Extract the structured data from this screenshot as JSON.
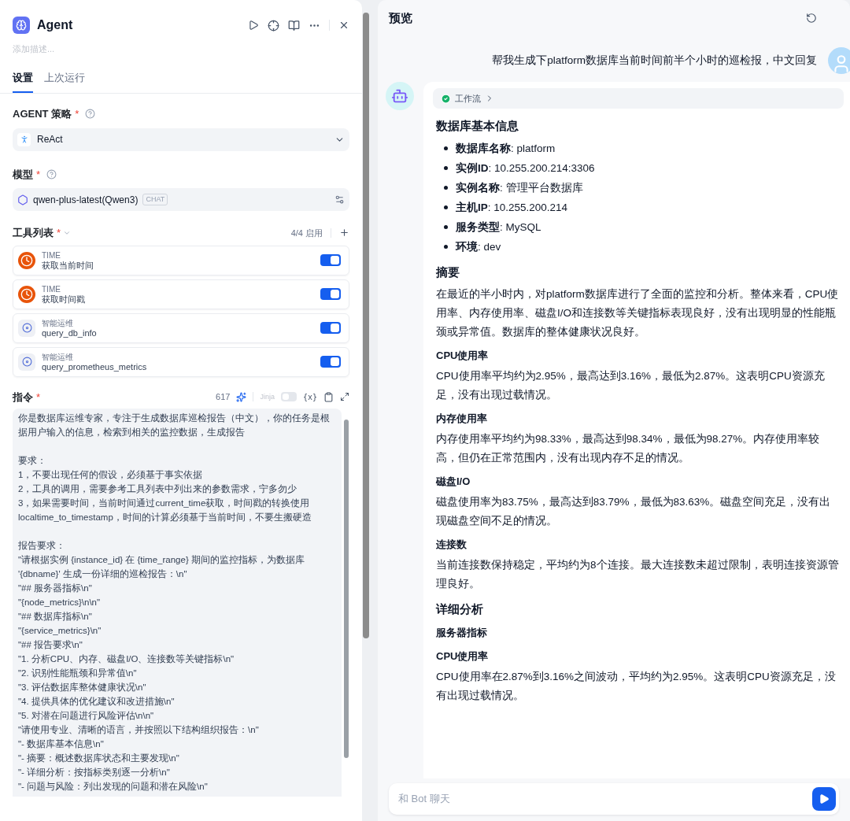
{
  "node": {
    "title": "Agent",
    "description_placeholder": "添加描述..."
  },
  "tabs": [
    {
      "label": "设置",
      "selected": true
    },
    {
      "label": "上次运行",
      "selected": false
    }
  ],
  "strategy": {
    "label": "AGENT 策略",
    "mark": "*",
    "value": "ReAct"
  },
  "model": {
    "label": "模型",
    "mark": "*",
    "value": "qwen-plus-latest(Qwen3)",
    "badge": "CHAT"
  },
  "tools": {
    "label": "工具列表",
    "mark": "*",
    "count": "4/4 启用",
    "items": [
      {
        "provider": "TIME",
        "name": "获取当前时间",
        "kind": "clock",
        "on": true
      },
      {
        "provider": "TIME",
        "name": "获取时间戳",
        "kind": "clock",
        "on": true
      },
      {
        "provider": "智能运维",
        "name": "query_db_info",
        "kind": "ops",
        "on": true
      },
      {
        "provider": "智能运维",
        "name": "query_prometheus_metrics",
        "kind": "ops",
        "on": true
      }
    ]
  },
  "instruction": {
    "label": "指令",
    "mark": "*",
    "count": "617",
    "jinja_label": "Jinja",
    "jinja_on": false,
    "variable_button": "{x}",
    "paragraphs": [
      [
        "你是数据库运维专家，专注于生成数据库巡检报告（中文），你的任务是根据用户输入的信息，检索到相关的监控数据，生成报告"
      ],
      [
        "要求：",
        "1，不要出现任何的假设，必须基于事实依据",
        "2，工具的调用，需要参考工具列表中列出来的参数需求，宁多勿少",
        "3，如果需要时间，当前时间通过current_time获取，时间戳的转换使用localtime_to_timestamp，时间的计算必须基于当前时间，不要生搬硬造"
      ],
      [
        "报告要求：",
        "\"请根据实例 {instance_id} 在 {time_range} 期间的监控指标，为数据库 '{dbname}' 生成一份详细的巡检报告：\\n\"",
        "\"## 服务器指标\\n\"",
        "\"{node_metrics}\\n\\n\"",
        "\"## 数据库指标\\n\"",
        "\"{service_metrics}\\n\"",
        "\"## 报告要求\\n\"",
        "\"1. 分析CPU、内存、磁盘I/O、连接数等关键指标\\n\"",
        "\"2. 识别性能瓶颈和异常值\\n\"",
        "\"3. 评估数据库整体健康状况\\n\"",
        "\"4. 提供具体的优化建议和改进措施\\n\"",
        "\"5. 对潜在问题进行风险评估\\n\\n\"",
        "\"请使用专业、清晰的语言，并按照以下结构组织报告：\\n\"",
        "\"- 数据库基本信息\\n\"",
        "\"- 摘要：概述数据库状态和主要发现\\n\"",
        "\"- 详细分析：按指标类别逐一分析\\n\"",
        "\"- 问题与风险：列出发现的问题和潜在风险\\n\""
      ]
    ]
  },
  "preview": {
    "title": "预览",
    "user_message": "帮我生成下platform数据库当前时间前半个小时的巡检报，中文回复",
    "workflow_label": "工作流",
    "workflow_ok": true,
    "answer": [
      {
        "kind": "h2",
        "text": "数据库基本信息"
      },
      {
        "kind": "list",
        "items": [
          "**数据库名称**: platform",
          "**实例ID**: 10.255.200.214:3306",
          "**实例名称**: 管理平台数据库",
          "**主机IP**: 10.255.200.214",
          "**服务类型**: MySQL",
          "**环境**: dev"
        ]
      },
      {
        "kind": "h2",
        "text": "摘要"
      },
      {
        "kind": "p",
        "text": "在最近的半小时内，对platform数据库进行了全面的监控和分析。整体来看，CPU使用率、内存使用率、磁盘I/O和连接数等关键指标表现良好，没有出现明显的性能瓶颈或异常值。数据库的整体健康状况良好。"
      },
      {
        "kind": "h3",
        "text": "CPU使用率"
      },
      {
        "kind": "p",
        "text": "CPU使用率平均约为2.95%，最高达到3.16%，最低为2.87%。这表明CPU资源充足，没有出现过载情况。"
      },
      {
        "kind": "h3",
        "text": "内存使用率"
      },
      {
        "kind": "p",
        "text": "内存使用率平均约为98.33%，最高达到98.34%，最低为98.27%。内存使用率较高，但仍在正常范围内，没有出现内存不足的情况。"
      },
      {
        "kind": "h3",
        "text": "磁盘I/O"
      },
      {
        "kind": "p",
        "text": "磁盘使用率为83.75%，最高达到83.79%，最低为83.63%。磁盘空间充足，没有出现磁盘空间不足的情况。"
      },
      {
        "kind": "h3",
        "text": "连接数"
      },
      {
        "kind": "p",
        "text": "当前连接数保持稳定，平均约为8个连接。最大连接数未超过限制，表明连接资源管理良好。"
      },
      {
        "kind": "h2",
        "text": "详细分析"
      },
      {
        "kind": "h3",
        "text": "服务器指标"
      },
      {
        "kind": "h3",
        "text": "CPU使用率"
      },
      {
        "kind": "p",
        "text": "CPU使用率在2.87%到3.16%之间波动，平均约为2.95%。这表明CPU资源充足，没有出现过载情况。"
      }
    ],
    "input_placeholder": "和 Bot 聊天"
  }
}
